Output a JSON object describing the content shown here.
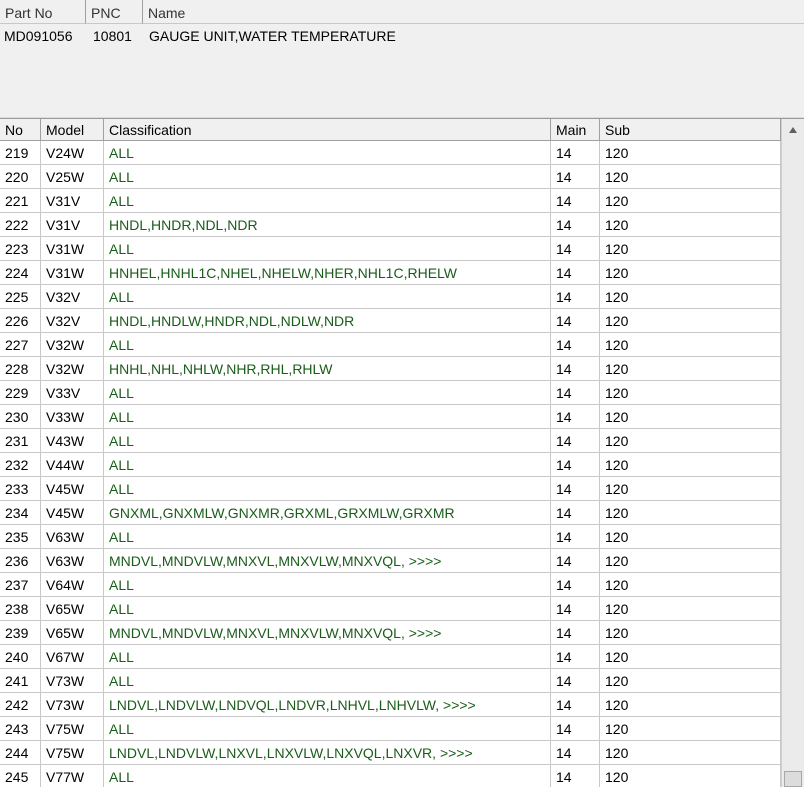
{
  "part_header": {
    "columns": [
      "Part No",
      "PNC",
      "Name"
    ],
    "part_no": "MD091056",
    "pnc": "10801",
    "name": "GAUGE UNIT,WATER TEMPERATURE"
  },
  "grid": {
    "columns": {
      "no": "No",
      "model": "Model",
      "classification": "Classification",
      "main": "Main",
      "sub": "Sub"
    },
    "rows": [
      {
        "no": "219",
        "model": "V24W",
        "classification": "ALL",
        "main": "14",
        "sub": "120"
      },
      {
        "no": "220",
        "model": "V25W",
        "classification": "ALL",
        "main": "14",
        "sub": "120"
      },
      {
        "no": "221",
        "model": "V31V",
        "classification": "ALL",
        "main": "14",
        "sub": "120"
      },
      {
        "no": "222",
        "model": "V31V",
        "classification": "HNDL,HNDR,NDL,NDR",
        "main": "14",
        "sub": "120"
      },
      {
        "no": "223",
        "model": "V31W",
        "classification": "ALL",
        "main": "14",
        "sub": "120"
      },
      {
        "no": "224",
        "model": "V31W",
        "classification": "HNHEL,HNHL1C,NHEL,NHELW,NHER,NHL1C,RHELW",
        "main": "14",
        "sub": "120"
      },
      {
        "no": "225",
        "model": "V32V",
        "classification": "ALL",
        "main": "14",
        "sub": "120"
      },
      {
        "no": "226",
        "model": "V32V",
        "classification": "HNDL,HNDLW,HNDR,NDL,NDLW,NDR",
        "main": "14",
        "sub": "120"
      },
      {
        "no": "227",
        "model": "V32W",
        "classification": "ALL",
        "main": "14",
        "sub": "120"
      },
      {
        "no": "228",
        "model": "V32W",
        "classification": "HNHL,NHL,NHLW,NHR,RHL,RHLW",
        "main": "14",
        "sub": "120"
      },
      {
        "no": "229",
        "model": "V33V",
        "classification": "ALL",
        "main": "14",
        "sub": "120"
      },
      {
        "no": "230",
        "model": "V33W",
        "classification": "ALL",
        "main": "14",
        "sub": "120"
      },
      {
        "no": "231",
        "model": "V43W",
        "classification": "ALL",
        "main": "14",
        "sub": "120"
      },
      {
        "no": "232",
        "model": "V44W",
        "classification": "ALL",
        "main": "14",
        "sub": "120"
      },
      {
        "no": "233",
        "model": "V45W",
        "classification": "ALL",
        "main": "14",
        "sub": "120"
      },
      {
        "no": "234",
        "model": "V45W",
        "classification": "GNXML,GNXMLW,GNXMR,GRXML,GRXMLW,GRXMR",
        "main": "14",
        "sub": "120"
      },
      {
        "no": "235",
        "model": "V63W",
        "classification": "ALL",
        "main": "14",
        "sub": "120"
      },
      {
        "no": "236",
        "model": "V63W",
        "classification": "MNDVL,MNDVLW,MNXVL,MNXVLW,MNXVQL,  >>>>",
        "main": "14",
        "sub": "120"
      },
      {
        "no": "237",
        "model": "V64W",
        "classification": "ALL",
        "main": "14",
        "sub": "120"
      },
      {
        "no": "238",
        "model": "V65W",
        "classification": "ALL",
        "main": "14",
        "sub": "120"
      },
      {
        "no": "239",
        "model": "V65W",
        "classification": "MNDVL,MNDVLW,MNXVL,MNXVLW,MNXVQL,  >>>>",
        "main": "14",
        "sub": "120"
      },
      {
        "no": "240",
        "model": "V67W",
        "classification": "ALL",
        "main": "14",
        "sub": "120"
      },
      {
        "no": "241",
        "model": "V73W",
        "classification": "ALL",
        "main": "14",
        "sub": "120"
      },
      {
        "no": "242",
        "model": "V73W",
        "classification": "LNDVL,LNDVLW,LNDVQL,LNDVR,LNHVL,LNHVLW,  >>>>",
        "main": "14",
        "sub": "120"
      },
      {
        "no": "243",
        "model": "V75W",
        "classification": "ALL",
        "main": "14",
        "sub": "120"
      },
      {
        "no": "244",
        "model": "V75W",
        "classification": "LNDVL,LNDVLW,LNXVL,LNXVLW,LNXVQL,LNXVR,  >>>>",
        "main": "14",
        "sub": "120"
      },
      {
        "no": "245",
        "model": "V77W",
        "classification": "ALL",
        "main": "14",
        "sub": "120"
      }
    ]
  },
  "icons": {
    "scroll_up": "triangle-up-icon"
  }
}
